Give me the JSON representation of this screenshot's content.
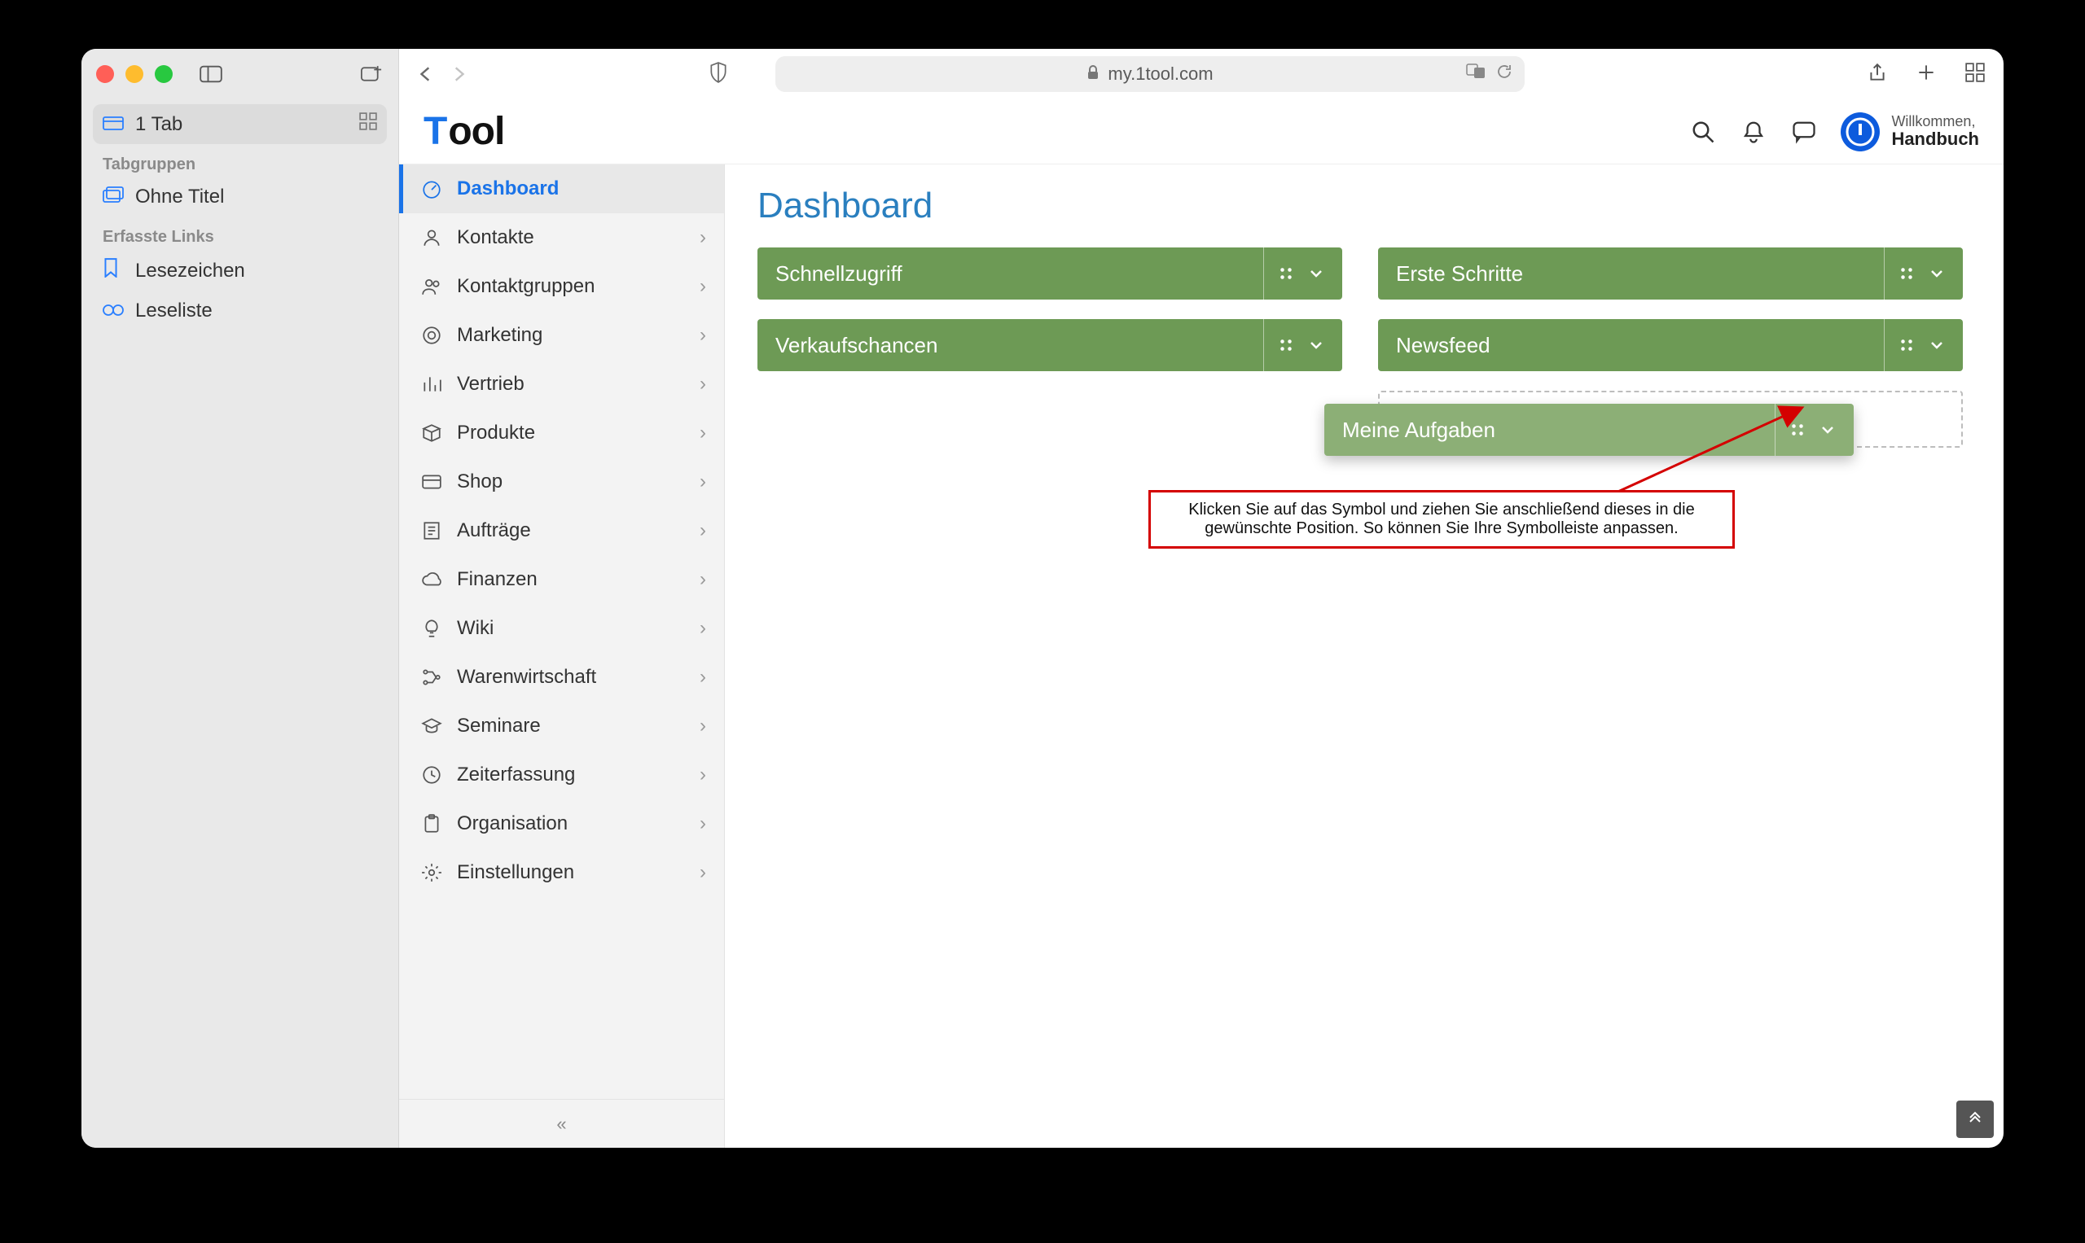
{
  "safari_sidebar": {
    "tab_label": "1 Tab",
    "groups_header": "Tabgruppen",
    "group_untitled": "Ohne Titel",
    "links_header": "Erfasste Links",
    "bookmarks": "Lesezeichen",
    "readlist": "Leseliste"
  },
  "addressbar": {
    "host": "my.1tool.com"
  },
  "header": {
    "logo_prefix": "T",
    "logo_rest": "ool",
    "welcome": "Willkommen,",
    "username": "Handbuch"
  },
  "sidebar": {
    "items": [
      {
        "label": "Dashboard",
        "active": true,
        "icon": "gauge"
      },
      {
        "label": "Kontakte",
        "icon": "user"
      },
      {
        "label": "Kontaktgruppen",
        "icon": "users"
      },
      {
        "label": "Marketing",
        "icon": "target"
      },
      {
        "label": "Vertrieb",
        "icon": "bars"
      },
      {
        "label": "Produkte",
        "icon": "box"
      },
      {
        "label": "Shop",
        "icon": "card"
      },
      {
        "label": "Aufträge",
        "icon": "receipt"
      },
      {
        "label": "Finanzen",
        "icon": "cloud"
      },
      {
        "label": "Wiki",
        "icon": "bulb"
      },
      {
        "label": "Warenwirtschaft",
        "icon": "flow"
      },
      {
        "label": "Seminare",
        "icon": "grad"
      },
      {
        "label": "Zeiterfassung",
        "icon": "clock"
      },
      {
        "label": "Organisation",
        "icon": "clipboard"
      },
      {
        "label": "Einstellungen",
        "icon": "gear"
      }
    ]
  },
  "dashboard": {
    "title": "Dashboard",
    "widgets": {
      "quick": "Schnellzugriff",
      "first": "Erste Schritte",
      "sales": "Verkaufschancen",
      "news": "Newsfeed",
      "tasks": "Meine Aufgaben"
    }
  },
  "annotation": "Klicken Sie auf das Symbol und ziehen Sie anschließend dieses in die gewünschte Position. So können Sie Ihre Symbolleiste anpassen."
}
